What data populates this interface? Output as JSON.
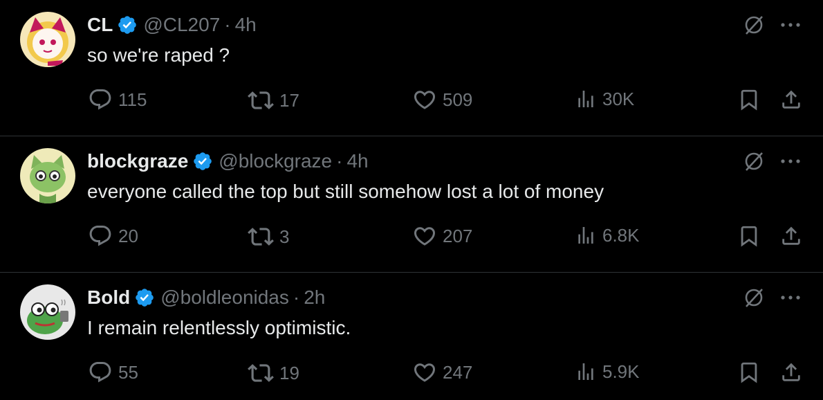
{
  "tweets": [
    {
      "name": "CL",
      "handle": "@CL207",
      "time": "4h",
      "text": "so we're raped ?",
      "replies": "115",
      "reposts": "17",
      "likes": "509",
      "views": "30K",
      "avatar_color": "#f4d36b"
    },
    {
      "name": "blockgraze",
      "handle": "@blockgraze",
      "time": "4h",
      "text": "everyone called the top but still somehow lost a lot of money",
      "replies": "20",
      "reposts": "3",
      "likes": "207",
      "views": "6.8K",
      "avatar_color": "#eee9b8"
    },
    {
      "name": "Bold",
      "handle": "@boldleonidas",
      "time": "2h",
      "text": "I remain relentlessly optimistic.",
      "replies": "55",
      "reposts": "19",
      "likes": "247",
      "views": "5.9K",
      "avatar_color": "#e6e6e6"
    }
  ],
  "separator": "·",
  "colors": {
    "verified": "#1d9bf0",
    "muted": "#71767b",
    "text": "#e7e9ea",
    "divider": "#2f3336"
  },
  "icons": [
    "verified-badge-icon",
    "grok-icon",
    "more-icon",
    "reply-icon",
    "repost-icon",
    "like-icon",
    "views-icon",
    "bookmark-icon",
    "share-icon"
  ]
}
